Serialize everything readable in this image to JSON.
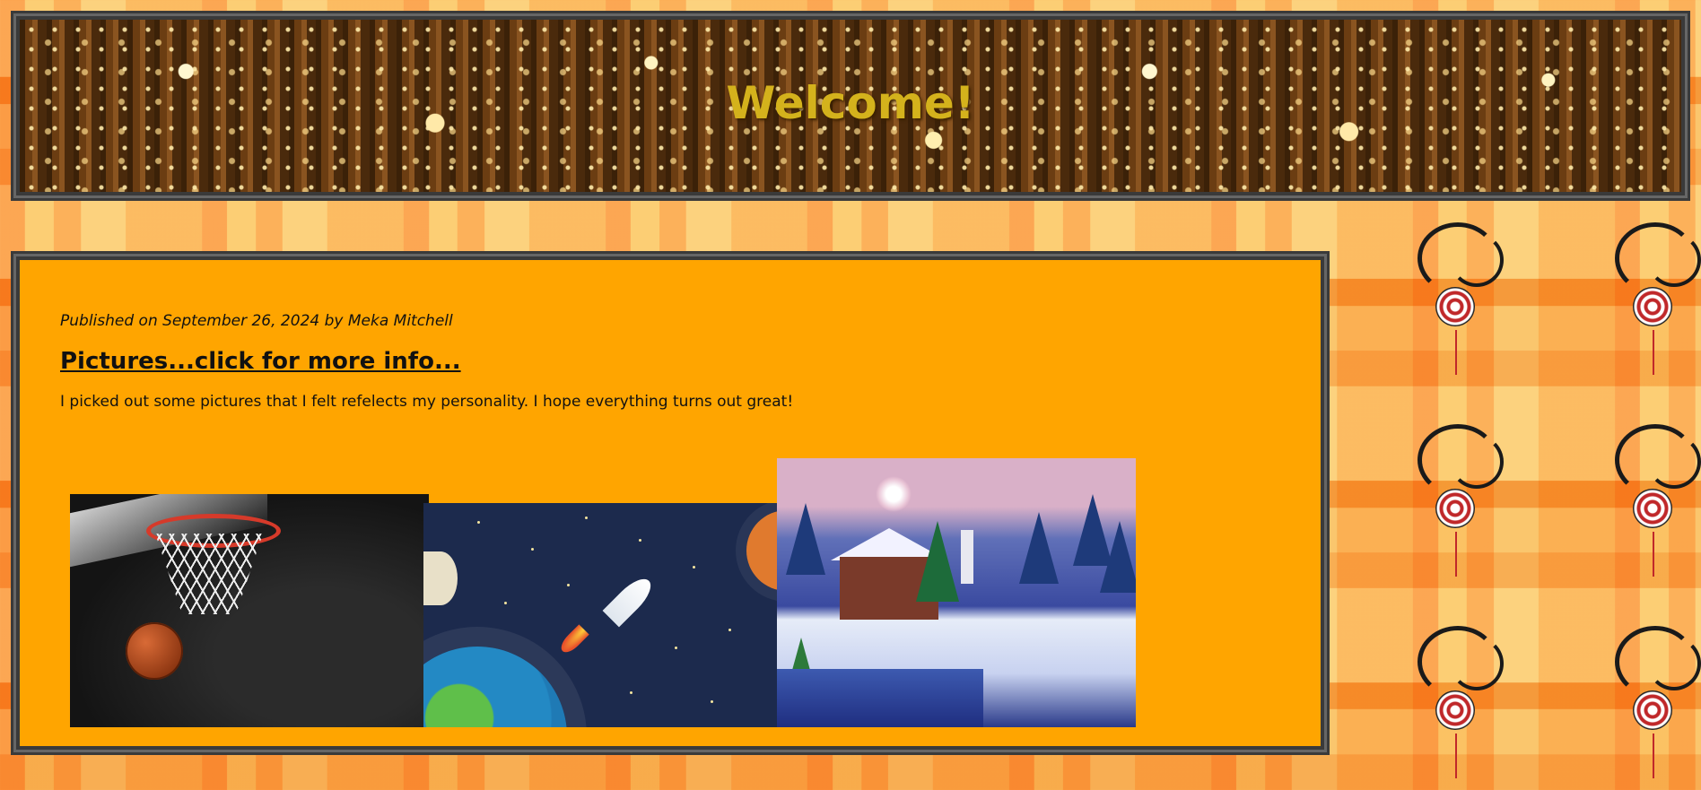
{
  "header": {
    "title": "Welcome!"
  },
  "post": {
    "meta": "Published on September 26, 2024 by Meka Mitchell",
    "title": "Pictures...click for more info...",
    "body": "I picked out some pictures that I felt refelects my personality. I hope everything turns out great!"
  },
  "pictures": [
    {
      "subject": "basketball"
    },
    {
      "subject": "rocket-in-space"
    },
    {
      "subject": "winter-village"
    }
  ],
  "colors": {
    "header_title": "#d4b21c",
    "post_background": "#ffa500",
    "frame_border": "#3a3a3a"
  }
}
